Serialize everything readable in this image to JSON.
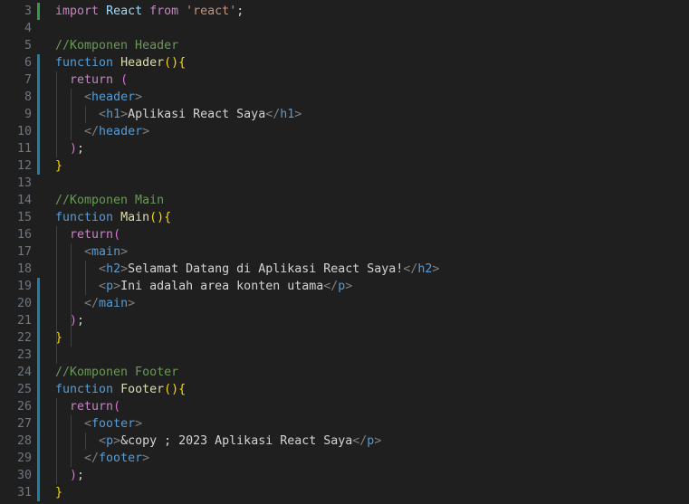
{
  "colors": {
    "background": "#1f1f1f",
    "line_number": "#6e7681",
    "keyword": "#569cd6",
    "control_keyword": "#c586c0",
    "function_name": "#dcdcaa",
    "string": "#ce9178",
    "comment": "#6a9955",
    "tag_angle": "#808080",
    "gutter_added": "#2ea043",
    "gutter_modified": "#1b81a8"
  },
  "editor": {
    "lines": [
      {
        "n": "3",
        "tokens": [
          [
            "kw2",
            "import"
          ],
          [
            "txt",
            " "
          ],
          [
            "id",
            "React"
          ],
          [
            "txt",
            " "
          ],
          [
            "kw2",
            "from"
          ],
          [
            "txt",
            " "
          ],
          [
            "str",
            "'react'"
          ],
          [
            "txt",
            ";"
          ]
        ]
      },
      {
        "n": "4",
        "tokens": []
      },
      {
        "n": "5",
        "tokens": [
          [
            "com",
            "//Komponen Header"
          ]
        ]
      },
      {
        "n": "6",
        "tokens": [
          [
            "kw",
            "function"
          ],
          [
            "txt",
            " "
          ],
          [
            "fn",
            "Header"
          ],
          [
            "b1",
            "()"
          ],
          [
            "b1",
            "{"
          ]
        ]
      },
      {
        "n": "7",
        "tokens": [
          [
            "txt",
            "  "
          ],
          [
            "kw2",
            "return"
          ],
          [
            "txt",
            " "
          ],
          [
            "b2",
            "("
          ]
        ]
      },
      {
        "n": "8",
        "tokens": [
          [
            "txt",
            "    "
          ],
          [
            "ang",
            "<"
          ],
          [
            "tag",
            "header"
          ],
          [
            "ang",
            ">"
          ]
        ]
      },
      {
        "n": "9",
        "tokens": [
          [
            "txt",
            "      "
          ],
          [
            "ang",
            "<"
          ],
          [
            "tag",
            "h1"
          ],
          [
            "ang",
            ">"
          ],
          [
            "txt",
            "Aplikasi React Saya"
          ],
          [
            "ang",
            "</"
          ],
          [
            "tag",
            "h1"
          ],
          [
            "ang",
            ">"
          ]
        ]
      },
      {
        "n": "10",
        "tokens": [
          [
            "txt",
            "    "
          ],
          [
            "ang",
            "</"
          ],
          [
            "tag",
            "header"
          ],
          [
            "ang",
            ">"
          ]
        ]
      },
      {
        "n": "11",
        "tokens": [
          [
            "txt",
            "  "
          ],
          [
            "b2",
            ")"
          ],
          [
            "txt",
            ";"
          ]
        ]
      },
      {
        "n": "12",
        "tokens": [
          [
            "b1",
            "}"
          ]
        ]
      },
      {
        "n": "13",
        "tokens": []
      },
      {
        "n": "14",
        "tokens": [
          [
            "com",
            "//Komponen Main"
          ]
        ]
      },
      {
        "n": "15",
        "tokens": [
          [
            "kw",
            "function"
          ],
          [
            "txt",
            " "
          ],
          [
            "fn",
            "Main"
          ],
          [
            "b1",
            "()"
          ],
          [
            "b1",
            "{"
          ]
        ]
      },
      {
        "n": "16",
        "tokens": [
          [
            "txt",
            "  "
          ],
          [
            "kw2",
            "return"
          ],
          [
            "b2",
            "("
          ]
        ]
      },
      {
        "n": "17",
        "tokens": [
          [
            "txt",
            "    "
          ],
          [
            "ang",
            "<"
          ],
          [
            "tag",
            "main"
          ],
          [
            "ang",
            ">"
          ]
        ]
      },
      {
        "n": "18",
        "tokens": [
          [
            "txt",
            "      "
          ],
          [
            "ang",
            "<"
          ],
          [
            "tag",
            "h2"
          ],
          [
            "ang",
            ">"
          ],
          [
            "txt",
            "Selamat Datang di Aplikasi React Saya!"
          ],
          [
            "ang",
            "</"
          ],
          [
            "tag",
            "h2"
          ],
          [
            "ang",
            ">"
          ]
        ]
      },
      {
        "n": "19",
        "tokens": [
          [
            "txt",
            "      "
          ],
          [
            "ang",
            "<"
          ],
          [
            "tag",
            "p"
          ],
          [
            "ang",
            ">"
          ],
          [
            "txt",
            "Ini adalah area konten utama"
          ],
          [
            "ang",
            "</"
          ],
          [
            "tag",
            "p"
          ],
          [
            "ang",
            ">"
          ]
        ]
      },
      {
        "n": "20",
        "tokens": [
          [
            "txt",
            "    "
          ],
          [
            "ang",
            "</"
          ],
          [
            "tag",
            "main"
          ],
          [
            "ang",
            ">"
          ]
        ]
      },
      {
        "n": "21",
        "tokens": [
          [
            "txt",
            "  "
          ],
          [
            "b2",
            ")"
          ],
          [
            "txt",
            ";"
          ]
        ]
      },
      {
        "n": "22",
        "tokens": [
          [
            "b1",
            "}"
          ]
        ]
      },
      {
        "n": "23",
        "tokens": []
      },
      {
        "n": "24",
        "tokens": [
          [
            "com",
            "//Komponen Footer"
          ]
        ]
      },
      {
        "n": "25",
        "tokens": [
          [
            "kw",
            "function"
          ],
          [
            "txt",
            " "
          ],
          [
            "fn",
            "Footer"
          ],
          [
            "b1",
            "()"
          ],
          [
            "b1",
            "{"
          ]
        ]
      },
      {
        "n": "26",
        "tokens": [
          [
            "txt",
            "  "
          ],
          [
            "kw2",
            "return"
          ],
          [
            "b2",
            "("
          ]
        ]
      },
      {
        "n": "27",
        "tokens": [
          [
            "txt",
            "    "
          ],
          [
            "ang",
            "<"
          ],
          [
            "tag",
            "footer"
          ],
          [
            "ang",
            ">"
          ]
        ]
      },
      {
        "n": "28",
        "tokens": [
          [
            "txt",
            "      "
          ],
          [
            "ang",
            "<"
          ],
          [
            "tag",
            "p"
          ],
          [
            "ang",
            ">"
          ],
          [
            "txt",
            "&copy ; 2023 Aplikasi React Saya"
          ],
          [
            "ang",
            "</"
          ],
          [
            "tag",
            "p"
          ],
          [
            "ang",
            ">"
          ]
        ]
      },
      {
        "n": "29",
        "tokens": [
          [
            "txt",
            "    "
          ],
          [
            "ang",
            "</"
          ],
          [
            "tag",
            "footer"
          ],
          [
            "ang",
            ">"
          ]
        ]
      },
      {
        "n": "30",
        "tokens": [
          [
            "txt",
            "  "
          ],
          [
            "b2",
            ")"
          ],
          [
            "txt",
            ";"
          ]
        ]
      },
      {
        "n": "31",
        "tokens": [
          [
            "b1",
            "}"
          ]
        ]
      }
    ]
  }
}
